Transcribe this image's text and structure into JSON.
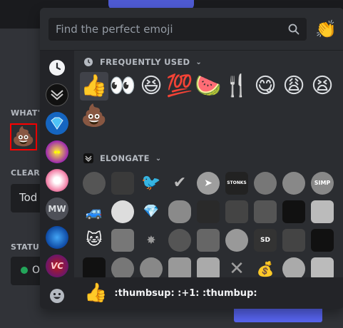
{
  "background": {
    "labels": {
      "whats_up": "WHAT'S",
      "clear_after": "CLEAR A",
      "status": "STATUS"
    },
    "custom_status_value": "Tod",
    "status_value": "O",
    "selected_status_emoji": "💩"
  },
  "picker": {
    "search": {
      "placeholder": "Find the perfect emoji"
    },
    "diversity_emoji": "👏",
    "nav": {
      "recent_icon": "clock-icon",
      "footer_icon": "smiley-icon",
      "servers": [
        {
          "name": "server-1"
        },
        {
          "name": "server-elongate"
        },
        {
          "name": "server-3"
        },
        {
          "name": "server-4"
        },
        {
          "name": "server-5"
        },
        {
          "name": "server-mw",
          "initials": "MW"
        },
        {
          "name": "server-7"
        },
        {
          "name": "server-vc",
          "initials": "VC"
        }
      ]
    },
    "sections": {
      "frequently_used": {
        "title": "FREQUENTLY USED",
        "emojis": [
          "👍",
          "👀",
          "😆",
          "💯",
          "🍉",
          "🍴",
          "😋",
          "😩",
          "😫",
          "💩"
        ]
      },
      "elongate": {
        "title": "ELONGATE",
        "custom": [
          "",
          "",
          "",
          "✔",
          "",
          "STONKS",
          "",
          "",
          "SIMP",
          "",
          "",
          "",
          "",
          "",
          "",
          "",
          "",
          "",
          "",
          "",
          "",
          "",
          "",
          "SD",
          "",
          "",
          "",
          "",
          "",
          "",
          "",
          "",
          "✕",
          "",
          "",
          ""
        ]
      }
    },
    "preview": {
      "emoji": "👍",
      "text": ":thumbsup: :+1: :thumbup:"
    }
  }
}
